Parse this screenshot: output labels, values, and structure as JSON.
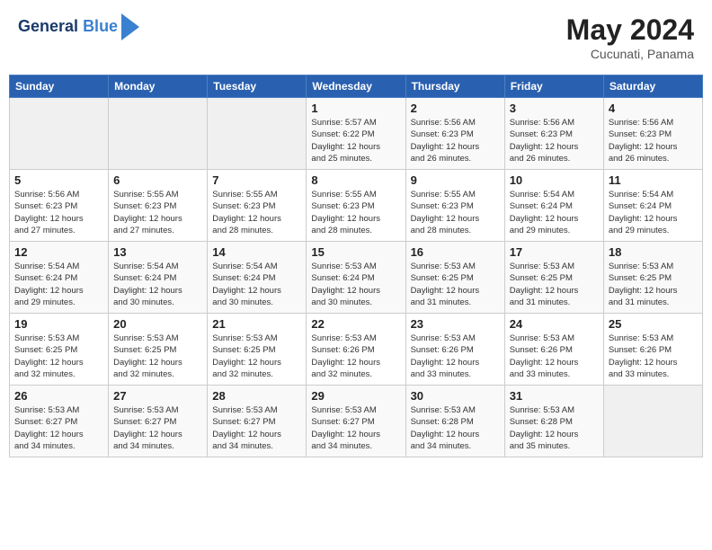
{
  "logo": {
    "line1": "General",
    "line2": "Blue"
  },
  "title": "May 2024",
  "subtitle": "Cucunati, Panama",
  "days_header": [
    "Sunday",
    "Monday",
    "Tuesday",
    "Wednesday",
    "Thursday",
    "Friday",
    "Saturday"
  ],
  "weeks": [
    [
      {
        "day": "",
        "info": ""
      },
      {
        "day": "",
        "info": ""
      },
      {
        "day": "",
        "info": ""
      },
      {
        "day": "1",
        "info": "Sunrise: 5:57 AM\nSunset: 6:22 PM\nDaylight: 12 hours\nand 25 minutes."
      },
      {
        "day": "2",
        "info": "Sunrise: 5:56 AM\nSunset: 6:23 PM\nDaylight: 12 hours\nand 26 minutes."
      },
      {
        "day": "3",
        "info": "Sunrise: 5:56 AM\nSunset: 6:23 PM\nDaylight: 12 hours\nand 26 minutes."
      },
      {
        "day": "4",
        "info": "Sunrise: 5:56 AM\nSunset: 6:23 PM\nDaylight: 12 hours\nand 26 minutes."
      }
    ],
    [
      {
        "day": "5",
        "info": "Sunrise: 5:56 AM\nSunset: 6:23 PM\nDaylight: 12 hours\nand 27 minutes."
      },
      {
        "day": "6",
        "info": "Sunrise: 5:55 AM\nSunset: 6:23 PM\nDaylight: 12 hours\nand 27 minutes."
      },
      {
        "day": "7",
        "info": "Sunrise: 5:55 AM\nSunset: 6:23 PM\nDaylight: 12 hours\nand 28 minutes."
      },
      {
        "day": "8",
        "info": "Sunrise: 5:55 AM\nSunset: 6:23 PM\nDaylight: 12 hours\nand 28 minutes."
      },
      {
        "day": "9",
        "info": "Sunrise: 5:55 AM\nSunset: 6:23 PM\nDaylight: 12 hours\nand 28 minutes."
      },
      {
        "day": "10",
        "info": "Sunrise: 5:54 AM\nSunset: 6:24 PM\nDaylight: 12 hours\nand 29 minutes."
      },
      {
        "day": "11",
        "info": "Sunrise: 5:54 AM\nSunset: 6:24 PM\nDaylight: 12 hours\nand 29 minutes."
      }
    ],
    [
      {
        "day": "12",
        "info": "Sunrise: 5:54 AM\nSunset: 6:24 PM\nDaylight: 12 hours\nand 29 minutes."
      },
      {
        "day": "13",
        "info": "Sunrise: 5:54 AM\nSunset: 6:24 PM\nDaylight: 12 hours\nand 30 minutes."
      },
      {
        "day": "14",
        "info": "Sunrise: 5:54 AM\nSunset: 6:24 PM\nDaylight: 12 hours\nand 30 minutes."
      },
      {
        "day": "15",
        "info": "Sunrise: 5:53 AM\nSunset: 6:24 PM\nDaylight: 12 hours\nand 30 minutes."
      },
      {
        "day": "16",
        "info": "Sunrise: 5:53 AM\nSunset: 6:25 PM\nDaylight: 12 hours\nand 31 minutes."
      },
      {
        "day": "17",
        "info": "Sunrise: 5:53 AM\nSunset: 6:25 PM\nDaylight: 12 hours\nand 31 minutes."
      },
      {
        "day": "18",
        "info": "Sunrise: 5:53 AM\nSunset: 6:25 PM\nDaylight: 12 hours\nand 31 minutes."
      }
    ],
    [
      {
        "day": "19",
        "info": "Sunrise: 5:53 AM\nSunset: 6:25 PM\nDaylight: 12 hours\nand 32 minutes."
      },
      {
        "day": "20",
        "info": "Sunrise: 5:53 AM\nSunset: 6:25 PM\nDaylight: 12 hours\nand 32 minutes."
      },
      {
        "day": "21",
        "info": "Sunrise: 5:53 AM\nSunset: 6:25 PM\nDaylight: 12 hours\nand 32 minutes."
      },
      {
        "day": "22",
        "info": "Sunrise: 5:53 AM\nSunset: 6:26 PM\nDaylight: 12 hours\nand 32 minutes."
      },
      {
        "day": "23",
        "info": "Sunrise: 5:53 AM\nSunset: 6:26 PM\nDaylight: 12 hours\nand 33 minutes."
      },
      {
        "day": "24",
        "info": "Sunrise: 5:53 AM\nSunset: 6:26 PM\nDaylight: 12 hours\nand 33 minutes."
      },
      {
        "day": "25",
        "info": "Sunrise: 5:53 AM\nSunset: 6:26 PM\nDaylight: 12 hours\nand 33 minutes."
      }
    ],
    [
      {
        "day": "26",
        "info": "Sunrise: 5:53 AM\nSunset: 6:27 PM\nDaylight: 12 hours\nand 34 minutes."
      },
      {
        "day": "27",
        "info": "Sunrise: 5:53 AM\nSunset: 6:27 PM\nDaylight: 12 hours\nand 34 minutes."
      },
      {
        "day": "28",
        "info": "Sunrise: 5:53 AM\nSunset: 6:27 PM\nDaylight: 12 hours\nand 34 minutes."
      },
      {
        "day": "29",
        "info": "Sunrise: 5:53 AM\nSunset: 6:27 PM\nDaylight: 12 hours\nand 34 minutes."
      },
      {
        "day": "30",
        "info": "Sunrise: 5:53 AM\nSunset: 6:28 PM\nDaylight: 12 hours\nand 34 minutes."
      },
      {
        "day": "31",
        "info": "Sunrise: 5:53 AM\nSunset: 6:28 PM\nDaylight: 12 hours\nand 35 minutes."
      },
      {
        "day": "",
        "info": ""
      }
    ]
  ]
}
